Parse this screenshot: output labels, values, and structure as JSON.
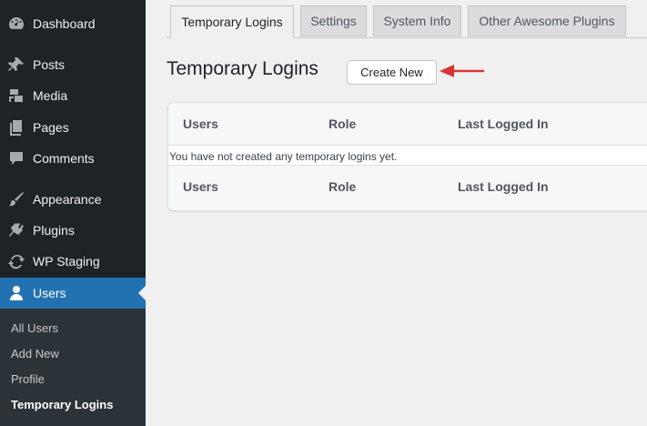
{
  "sidebar": {
    "items": [
      {
        "label": "Dashboard",
        "icon": "dashboard-icon"
      },
      {
        "label": "Posts",
        "icon": "pin-icon"
      },
      {
        "label": "Media",
        "icon": "media-icon"
      },
      {
        "label": "Pages",
        "icon": "pages-icon"
      },
      {
        "label": "Comments",
        "icon": "comment-icon"
      },
      {
        "label": "Appearance",
        "icon": "brush-icon"
      },
      {
        "label": "Plugins",
        "icon": "plug-icon"
      },
      {
        "label": "WP Staging",
        "icon": "refresh-icon"
      },
      {
        "label": "Users",
        "icon": "user-icon",
        "active": true
      }
    ],
    "submenu": [
      "All Users",
      "Add New",
      "Profile",
      "Temporary Logins"
    ],
    "submenu_current": "Temporary Logins"
  },
  "tabs": [
    {
      "label": "Temporary Logins",
      "active": true
    },
    {
      "label": "Settings"
    },
    {
      "label": "System Info"
    },
    {
      "label": "Other Awesome Plugins"
    }
  ],
  "page": {
    "title": "Temporary Logins",
    "create_button": "Create New"
  },
  "table": {
    "columns": [
      "Users",
      "Role",
      "Last Logged In"
    ],
    "empty_message": "You have not created any temporary logins yet."
  },
  "colors": {
    "sidebar_bg": "#1d2327",
    "active_bg": "#2271b1",
    "arrow": "#d63638"
  }
}
